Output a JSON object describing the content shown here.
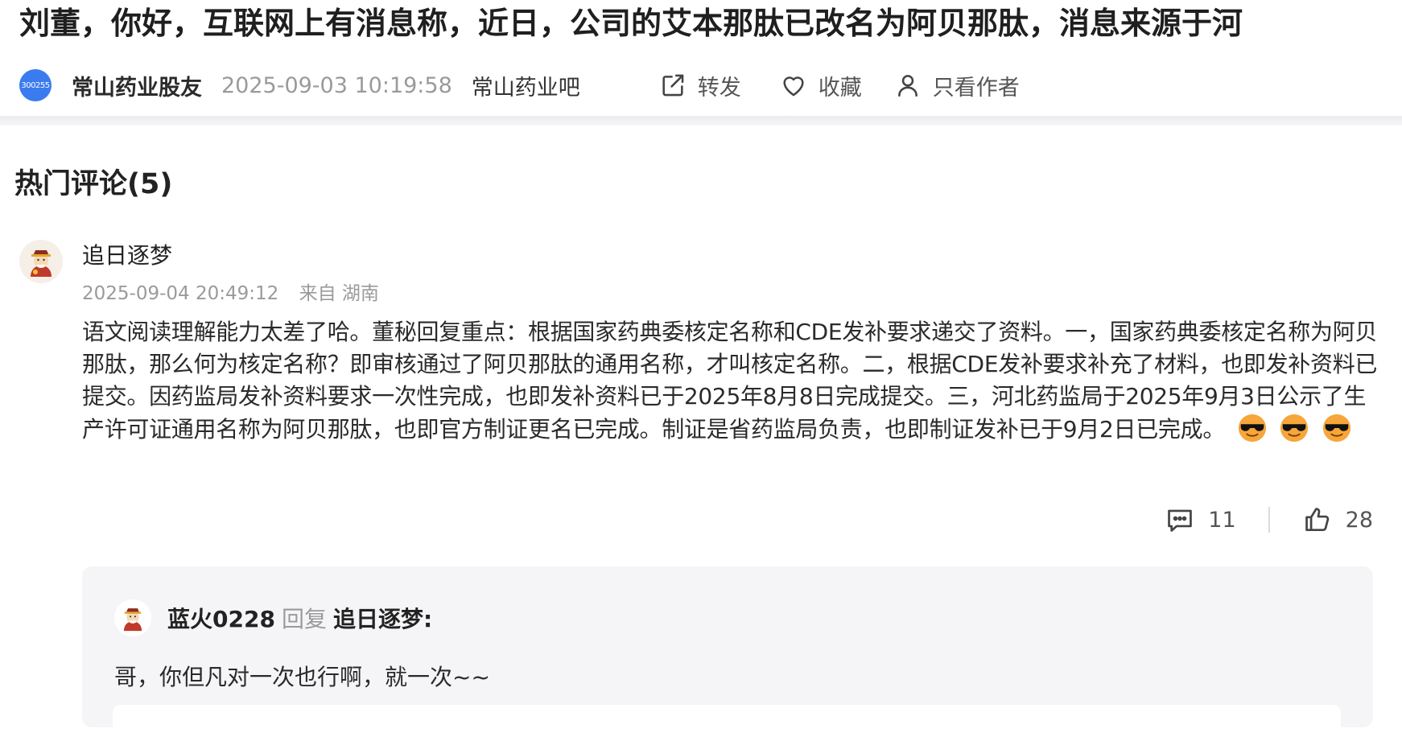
{
  "post": {
    "title": "刘董，你好，互联网上有消息称，近日，公司的艾本那肽已改名为阿贝那肽，消息来源于河",
    "stock_code": "300255",
    "author": "常山药业股友",
    "time": "2025-09-03 10:19:58",
    "forum": "常山药业吧",
    "actions": {
      "share": "转发",
      "favorite": "收藏",
      "author_only": "只看作者"
    }
  },
  "comments_section": {
    "title": "热门评论(5)",
    "comment": {
      "user": "追日逐梦",
      "time": "2025-09-04 20:49:12",
      "location": "来自 湖南",
      "body": "语文阅读理解能力太差了哈。董秘回复重点：根据国家药典委核定名称和CDE发补要求递交了资料。一，国家药典委核定名称为阿贝那肽，那么何为核定名称？即审核通过了阿贝那肽的通用名称，才叫核定名称。二，根据CDE发补要求补充了材料，也即发补资料已提交。因药监局发补资料要求一次性完成，也即发补资料已于2025年8月8日完成提交。三，河北药监局于2025年9月3日公示了生产许可证通用名称为阿贝那肽，也即官方制证更名已完成。制证是省药监局负责，也即制证发补已于9月2日已完成。",
      "emoji_count": 3,
      "reply_count": "11",
      "like_count": "28",
      "reply": {
        "user": "蓝火0228",
        "reply_word": "回复",
        "target": "追日逐梦:",
        "text": "哥，你但凡对一次也行啊，就一次~~"
      }
    }
  },
  "colors": {
    "stock_avatar": "#3a7bf0",
    "reply_bg": "#f5f5f7",
    "muted_text": "#9a9a9a"
  }
}
